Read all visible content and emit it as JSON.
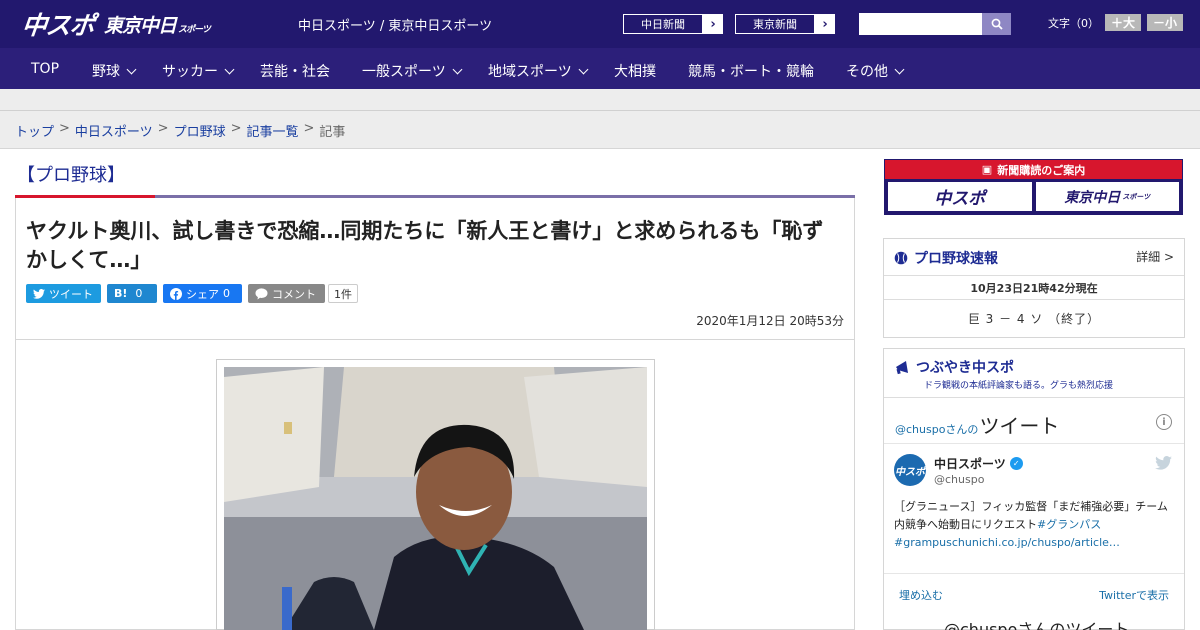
{
  "header": {
    "logo_main": "中スポ",
    "logo_sub": "東京中日",
    "logo_sub_small": "スポーツ",
    "site_title": "中日スポーツ / 東京中日スポーツ",
    "btn_chunichi": "中日新聞",
    "btn_tokyo": "東京新聞",
    "search_placeholder": "",
    "font_label": "文字（0）",
    "font_plus": "＋大",
    "font_minus": "－小"
  },
  "nav": {
    "items": [
      {
        "label": "TOP"
      },
      {
        "label": "野球"
      },
      {
        "label": "サッカー"
      },
      {
        "label": "芸能・社会"
      },
      {
        "label": "一般スポーツ"
      },
      {
        "label": "地域スポーツ"
      },
      {
        "label": "大相撲"
      },
      {
        "label": "競馬・ボート・競輪"
      },
      {
        "label": "その他"
      }
    ]
  },
  "breadcrumb": {
    "items": [
      "トップ",
      "中日スポーツ",
      "プロ野球",
      "記事一覧"
    ],
    "current": "記事",
    "sep": ">"
  },
  "article": {
    "category": "【プロ野球】",
    "headline": "ヤクルト奥川、試し書きで恐縮…同期たちに「新人王と書け」と求められるも「恥ずかしくて…」",
    "share": {
      "tweet": "ツイート",
      "hatena": "B!",
      "hatena_count": "0",
      "facebook": "シェア",
      "facebook_count": "0",
      "comment": "コメント",
      "comment_count": "1件"
    },
    "date": "2020年1月12日 20時53分"
  },
  "sidebar": {
    "promo_title": "新聞購読のご案内",
    "promo_btn1": "中スポ",
    "promo_btn2": "東京中日",
    "promo_btn2_small": "スポーツ",
    "score": {
      "title": "プロ野球速報",
      "detail": "詳細 >",
      "time": "10月23日21時42分現在",
      "game": "巨 3 － 4 ソ （終了）"
    },
    "tsubuyaki": {
      "title": "つぶやき中スポ",
      "subtitle": "ドラ観戦の本紙評論家も語る。グラも熱烈応援",
      "embed_handle": "@chuspoさんの",
      "embed_title": "ツイート",
      "info": "i",
      "user_name": "中日スポーツ",
      "verified": "✓",
      "user_handle": "@chuspo",
      "avatar_text": "中スポ",
      "tweet_text_1": "［グラニュース］フィッカ監督「まだ補強必要」チーム内競争へ始動日にリクエスト",
      "tweet_hashtag": "#グランパス",
      "tweet_link": "#grampuschunichi.co.jp/chuspo/article…",
      "embed_link": "埋め込む",
      "view_link": "Twitterで表示",
      "footer": "@chuspoさんのツイート"
    }
  },
  "colors": {
    "header": "#22186e",
    "nav": "#2c1f7a",
    "accent_red": "#d7162d",
    "link": "#1a3fa0"
  }
}
